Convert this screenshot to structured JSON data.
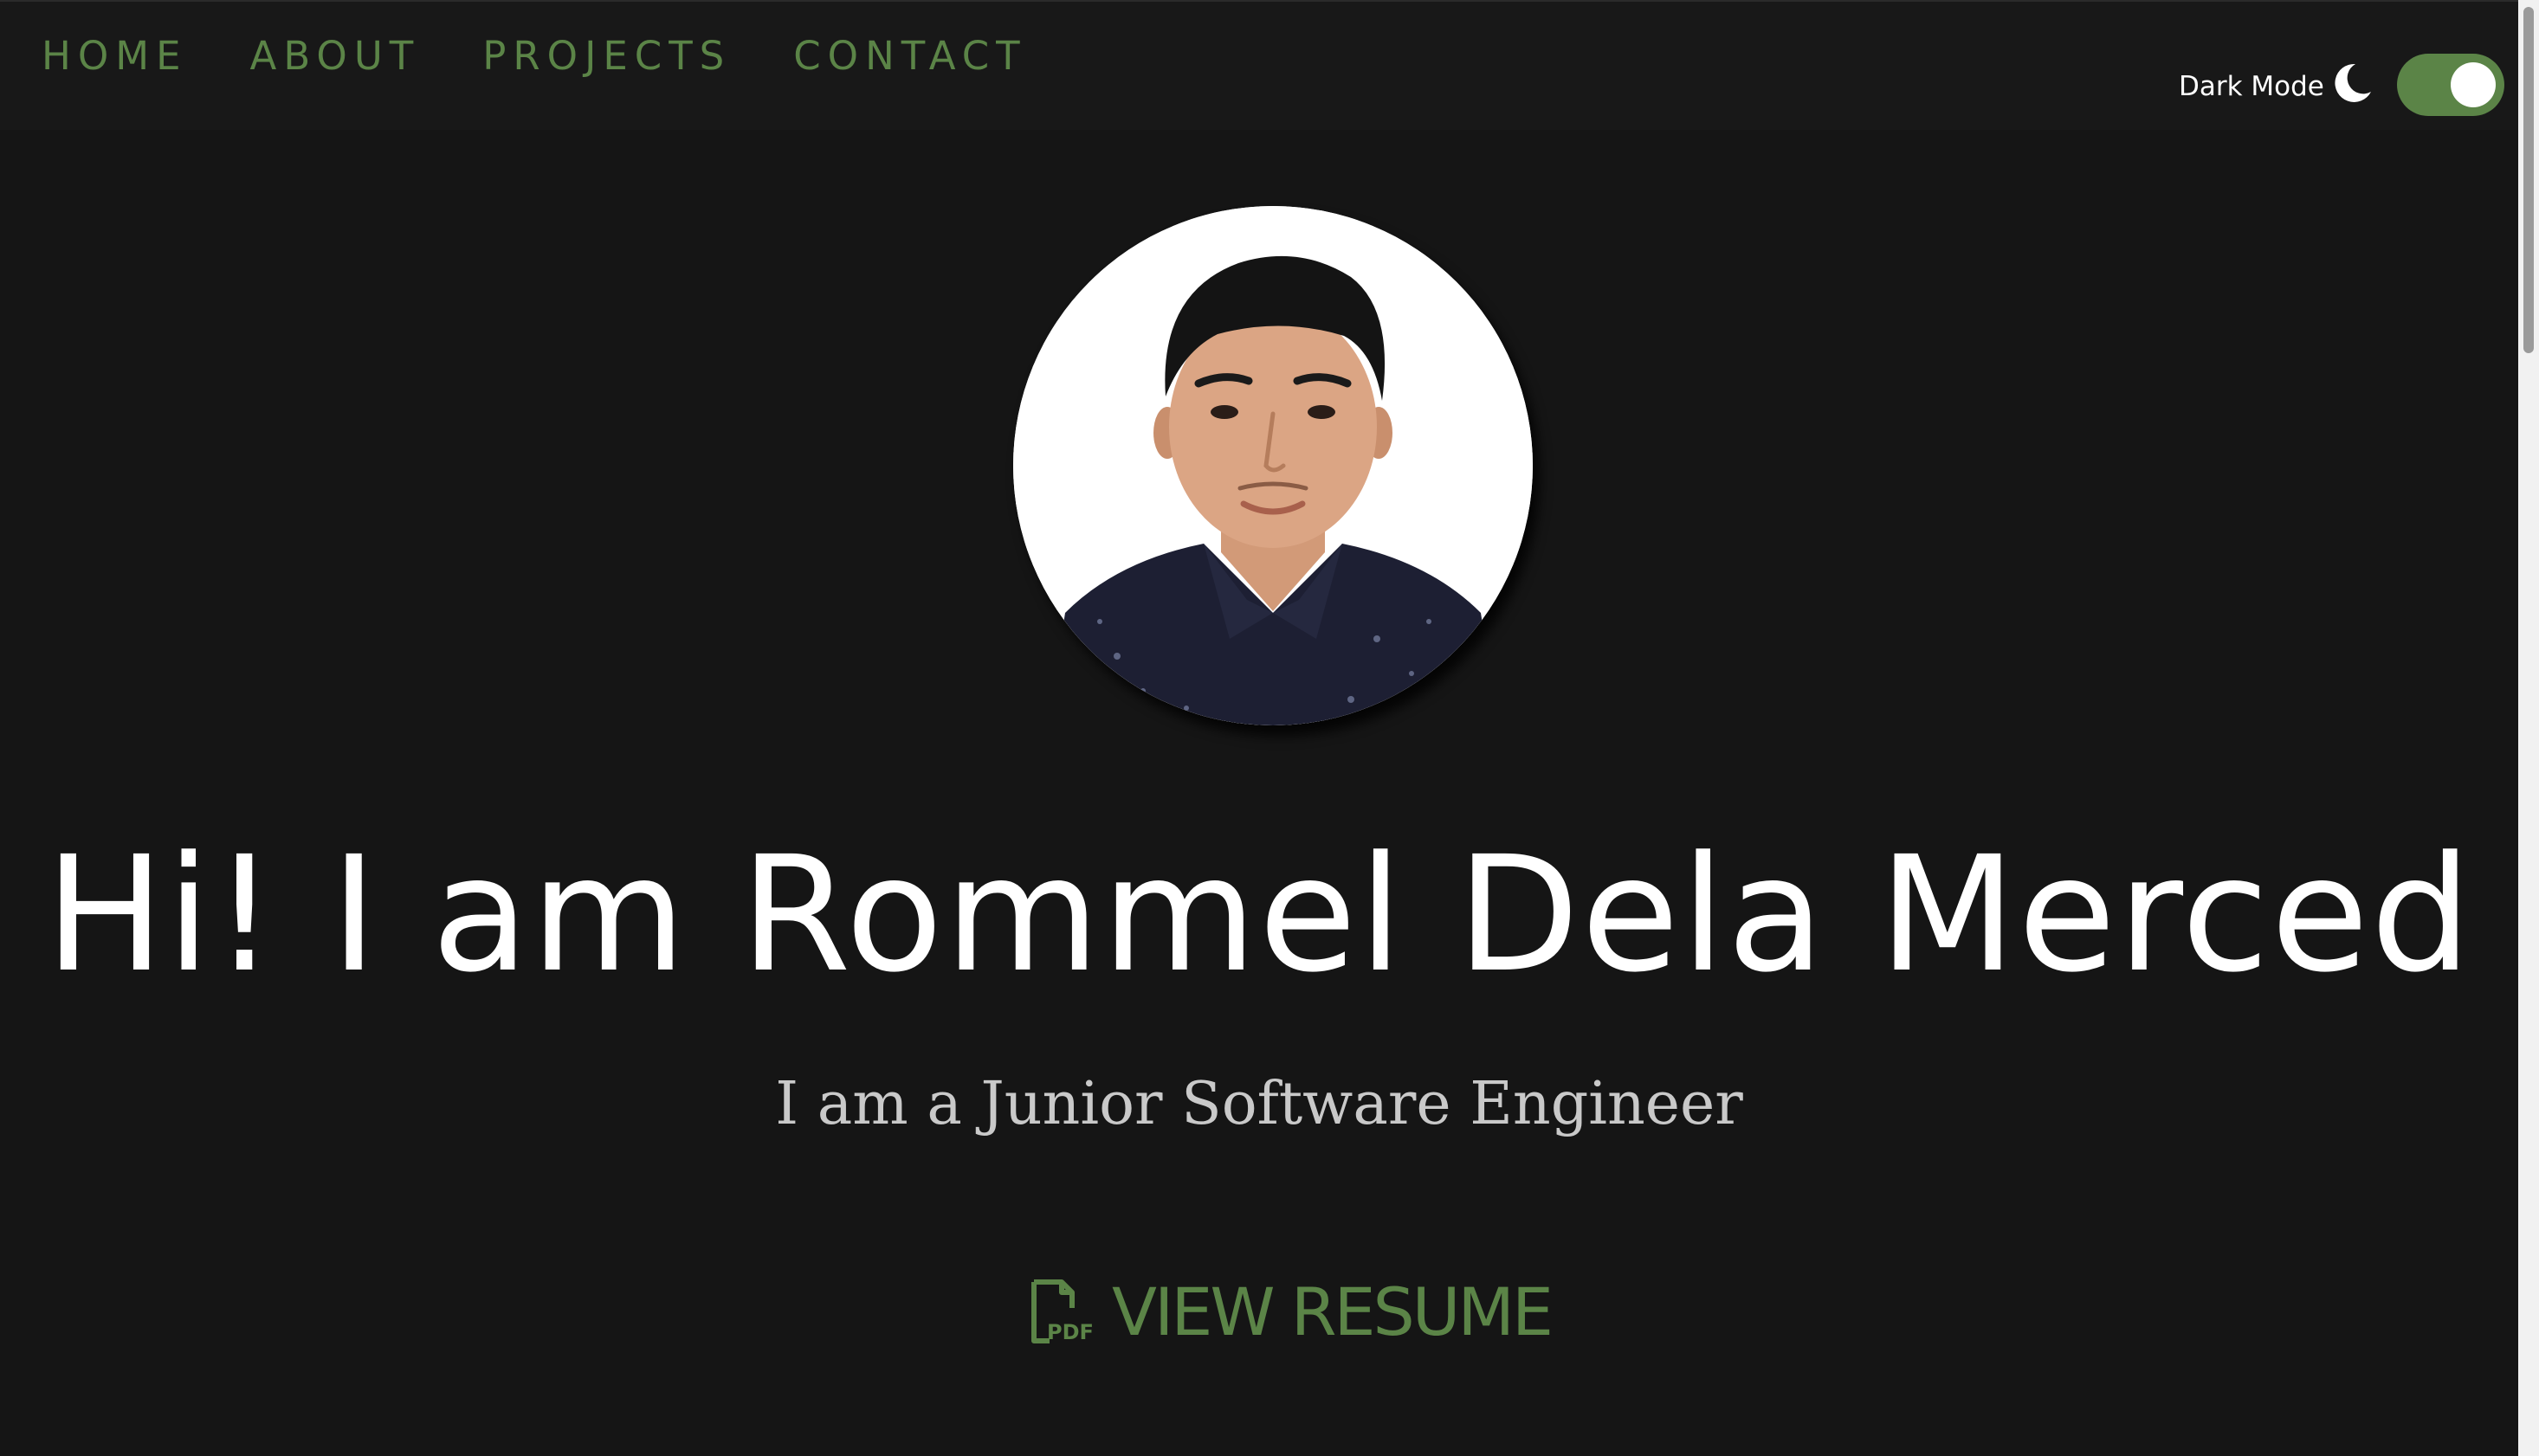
{
  "nav": {
    "items": [
      {
        "label": "HOME"
      },
      {
        "label": "ABOUT"
      },
      {
        "label": "PROJECTS"
      },
      {
        "label": "CONTACT"
      }
    ]
  },
  "theme": {
    "mode_label": "Dark Mode",
    "toggle_on": true,
    "accent_color": "#5b8447",
    "background_color": "#151515"
  },
  "hero": {
    "title": "Hi! I am Rommel Dela Merced",
    "subtitle": "I am a Junior Software Engineer",
    "resume_label": "VIEW RESUME",
    "resume_icon": "pdf-file-icon",
    "pdf_icon_text": "PDF"
  }
}
